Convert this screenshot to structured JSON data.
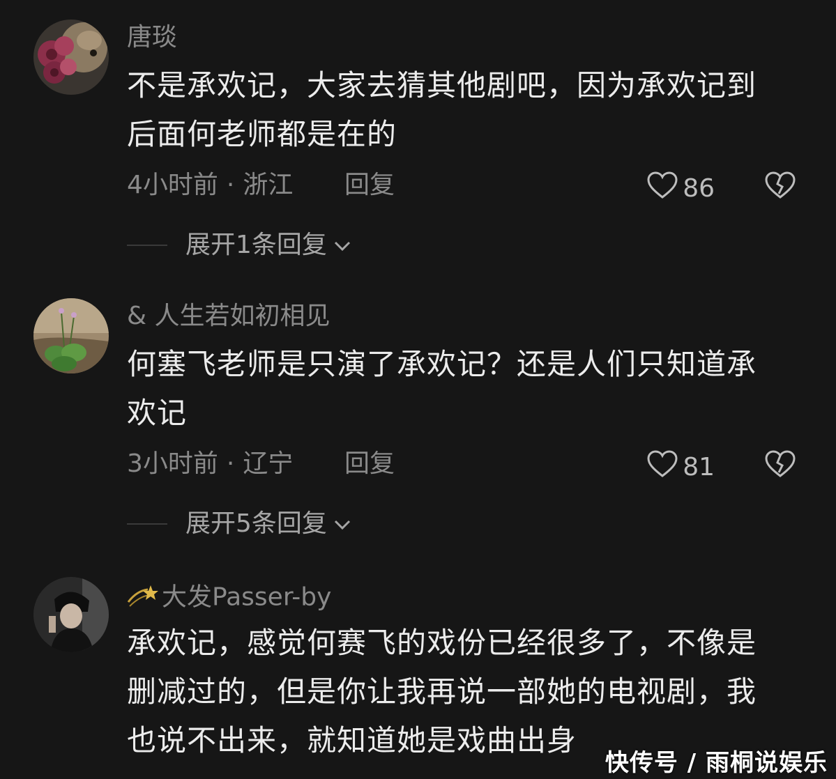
{
  "comments": [
    {
      "username": "唐琰",
      "text_lines": [
        "不是承欢记，大家去猜其他剧吧，因为承欢记到",
        "后面何老师都是在的"
      ],
      "time": "4小时前",
      "location": "浙江",
      "reply_label": "回复",
      "likes": "86",
      "expand_label": "展开1条回复"
    },
    {
      "username": "& 人生若如初相见",
      "text_lines": [
        "何塞飞老师是只演了承欢记？还是人们只知道承",
        "欢记"
      ],
      "time": "3小时前",
      "location": "辽宁",
      "reply_label": "回复",
      "likes": "81",
      "expand_label": "展开5条回复"
    },
    {
      "username": "大发Passer-by",
      "text_lines": [
        "承欢记，感觉何赛飞的戏份已经很多了，不像是",
        "删减过的，但是你让我再说一部她的电视剧，我",
        "也说不出来，就知道她是戏曲出身"
      ]
    }
  ],
  "separator": "·",
  "watermark": "快传号 / 雨桐说娱乐",
  "icons": {
    "like": "heart-outline-icon",
    "dislike": "broken-heart-icon",
    "expand": "chevron-down-icon",
    "badge": "shooting-star-icon"
  },
  "colors": {
    "background": "#161616",
    "text_primary": "#ececec",
    "text_secondary": "#8a8a8a"
  }
}
